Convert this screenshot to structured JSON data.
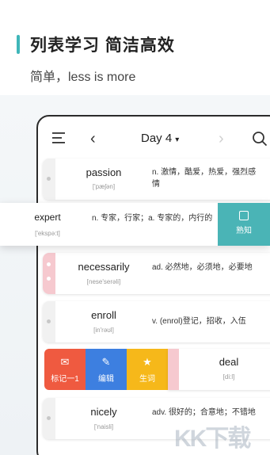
{
  "header": {
    "title": "列表学习 简洁高效",
    "subtitle": "简单，less is more"
  },
  "toolbar": {
    "day_label": "Day 4",
    "caret": "▾",
    "back_glyph": "‹",
    "forward_glyph": "›"
  },
  "words": [
    {
      "word": "passion",
      "ipa": "['pæʃən]",
      "definition": "n. 激情，酷爱，热爱，强烈感情"
    },
    {
      "word": "necessarily",
      "ipa": "[nese'serəli]",
      "definition": "ad. 必然地，必须地，必要地"
    },
    {
      "word": "enroll",
      "ipa": "[in'rəʊl]",
      "definition": "v. (enrol)登记，招收，入伍"
    },
    {
      "word": "nicely",
      "ipa": "['naisli]",
      "definition": "adv. 很好的；合意地；不错地"
    }
  ],
  "popped_word": {
    "word": "expert",
    "ipa": "['ekspə:t]",
    "definition": "n. 专家，行家；a. 专家的，内行的",
    "action_label": "熟知"
  },
  "swipe_actions": {
    "mark_label": "标记一1",
    "edit_label": "编辑",
    "vocab_label": "生词",
    "word": "deal",
    "ipa": "[di:l]"
  },
  "watermark": "KK下载",
  "colors": {
    "accent": "#3fb6b9",
    "mark": "#ef5a40",
    "edit": "#3d7fe0",
    "vocab": "#f6b81a",
    "known": "#4ab4b6"
  }
}
